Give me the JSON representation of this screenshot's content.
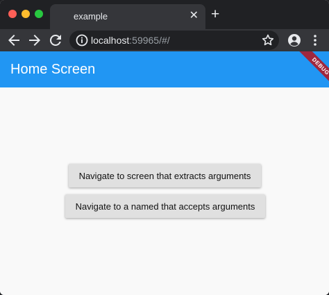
{
  "browser": {
    "tab": {
      "title": "example",
      "close_glyph": "✕"
    },
    "new_tab_glyph": "+",
    "url": {
      "host": "localhost",
      "rest": ":59965/#/"
    }
  },
  "app": {
    "title": "Home Screen",
    "debug_banner": "DEBUG",
    "colors": {
      "app_bar": "#2196f3",
      "debug_ribbon": "#a0273d",
      "button": "#e0e0e0"
    }
  },
  "buttons": [
    {
      "label": "Navigate to screen that extracts arguments"
    },
    {
      "label": "Navigate to a named that accepts arguments"
    }
  ],
  "icons": [
    "back-arrow-icon",
    "forward-arrow-icon",
    "reload-icon",
    "info-icon",
    "star-icon",
    "account-icon",
    "more-vert-icon"
  ]
}
